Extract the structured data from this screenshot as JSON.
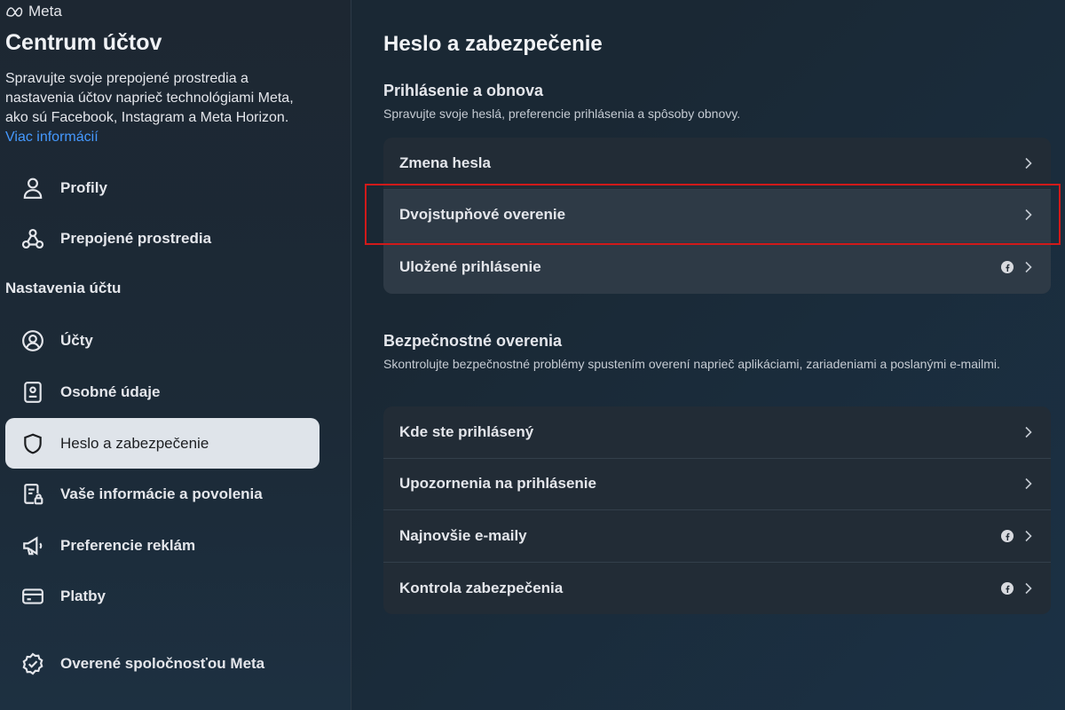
{
  "brand": {
    "name": "Meta"
  },
  "sidebar": {
    "title": "Centrum účtov",
    "description": "Spravujte svoje prepojené prostredia a nastavenia účtov naprieč technológiami Meta, ako sú Facebook, Instagram a Meta Horizon.",
    "more_link": "Viac informácií",
    "top_items": [
      {
        "label": "Profily",
        "icon": "person-icon"
      },
      {
        "label": "Prepojené prostredia",
        "icon": "connected-nodes-icon"
      }
    ],
    "section_label": "Nastavenia účtu",
    "items": [
      {
        "label": "Účty",
        "icon": "account-circle-icon"
      },
      {
        "label": "Osobné údaje",
        "icon": "id-card-icon"
      },
      {
        "label": "Heslo a zabezpečenie",
        "icon": "shield-icon",
        "active": true
      },
      {
        "label": "Vaše informácie a povolenia",
        "icon": "document-lock-icon"
      },
      {
        "label": "Preferencie reklám",
        "icon": "megaphone-icon"
      },
      {
        "label": "Platby",
        "icon": "credit-card-icon"
      }
    ],
    "bottom_item": {
      "label": "Overené spoločnosťou Meta",
      "icon": "verified-badge-icon"
    }
  },
  "main": {
    "title": "Heslo a zabezpečenie",
    "groups": [
      {
        "title": "Prihlásenie a obnova",
        "description": "Spravujte svoje heslá, preferencie prihlásenia a spôsoby obnovy.",
        "rows": [
          {
            "label": "Zmena hesla",
            "facebook": false
          },
          {
            "label": "Dvojstupňové overenie",
            "facebook": false,
            "highlighted": true
          },
          {
            "label": "Uložené prihlásenie",
            "facebook": true
          }
        ]
      },
      {
        "title": "Bezpečnostné overenia",
        "description": "Skontrolujte bezpečnostné problémy spustením overení naprieč aplikáciami, zariadeniami a poslanými e-mailmi.",
        "rows": [
          {
            "label": "Kde ste prihlásený",
            "facebook": false
          },
          {
            "label": "Upozornenia na prihlásenie",
            "facebook": false
          },
          {
            "label": "Najnovšie e-maily",
            "facebook": true
          },
          {
            "label": "Kontrola zabezpečenia",
            "facebook": true
          }
        ]
      }
    ]
  },
  "colors": {
    "link": "#4599ff",
    "active_item_bg": "#dfe4ea",
    "highlight_border": "#d11a1a"
  }
}
